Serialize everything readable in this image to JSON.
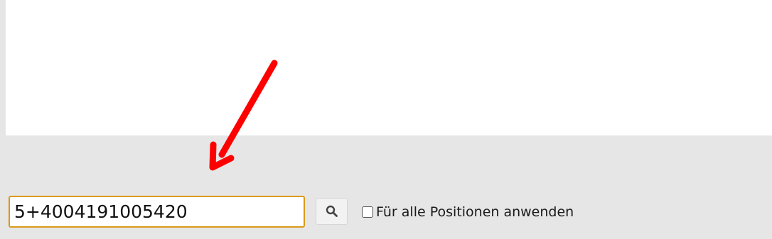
{
  "search": {
    "value": "5+4004191005420",
    "icon": "search-icon"
  },
  "apply_all": {
    "label": "Für alle Positionen anwenden",
    "checked": false
  },
  "annotation": {
    "icon": "red-arrow",
    "color": "#ff0000"
  },
  "colors": {
    "input_border": "#d99a1a",
    "background": "#e6e6e6",
    "panel": "#ffffff"
  }
}
